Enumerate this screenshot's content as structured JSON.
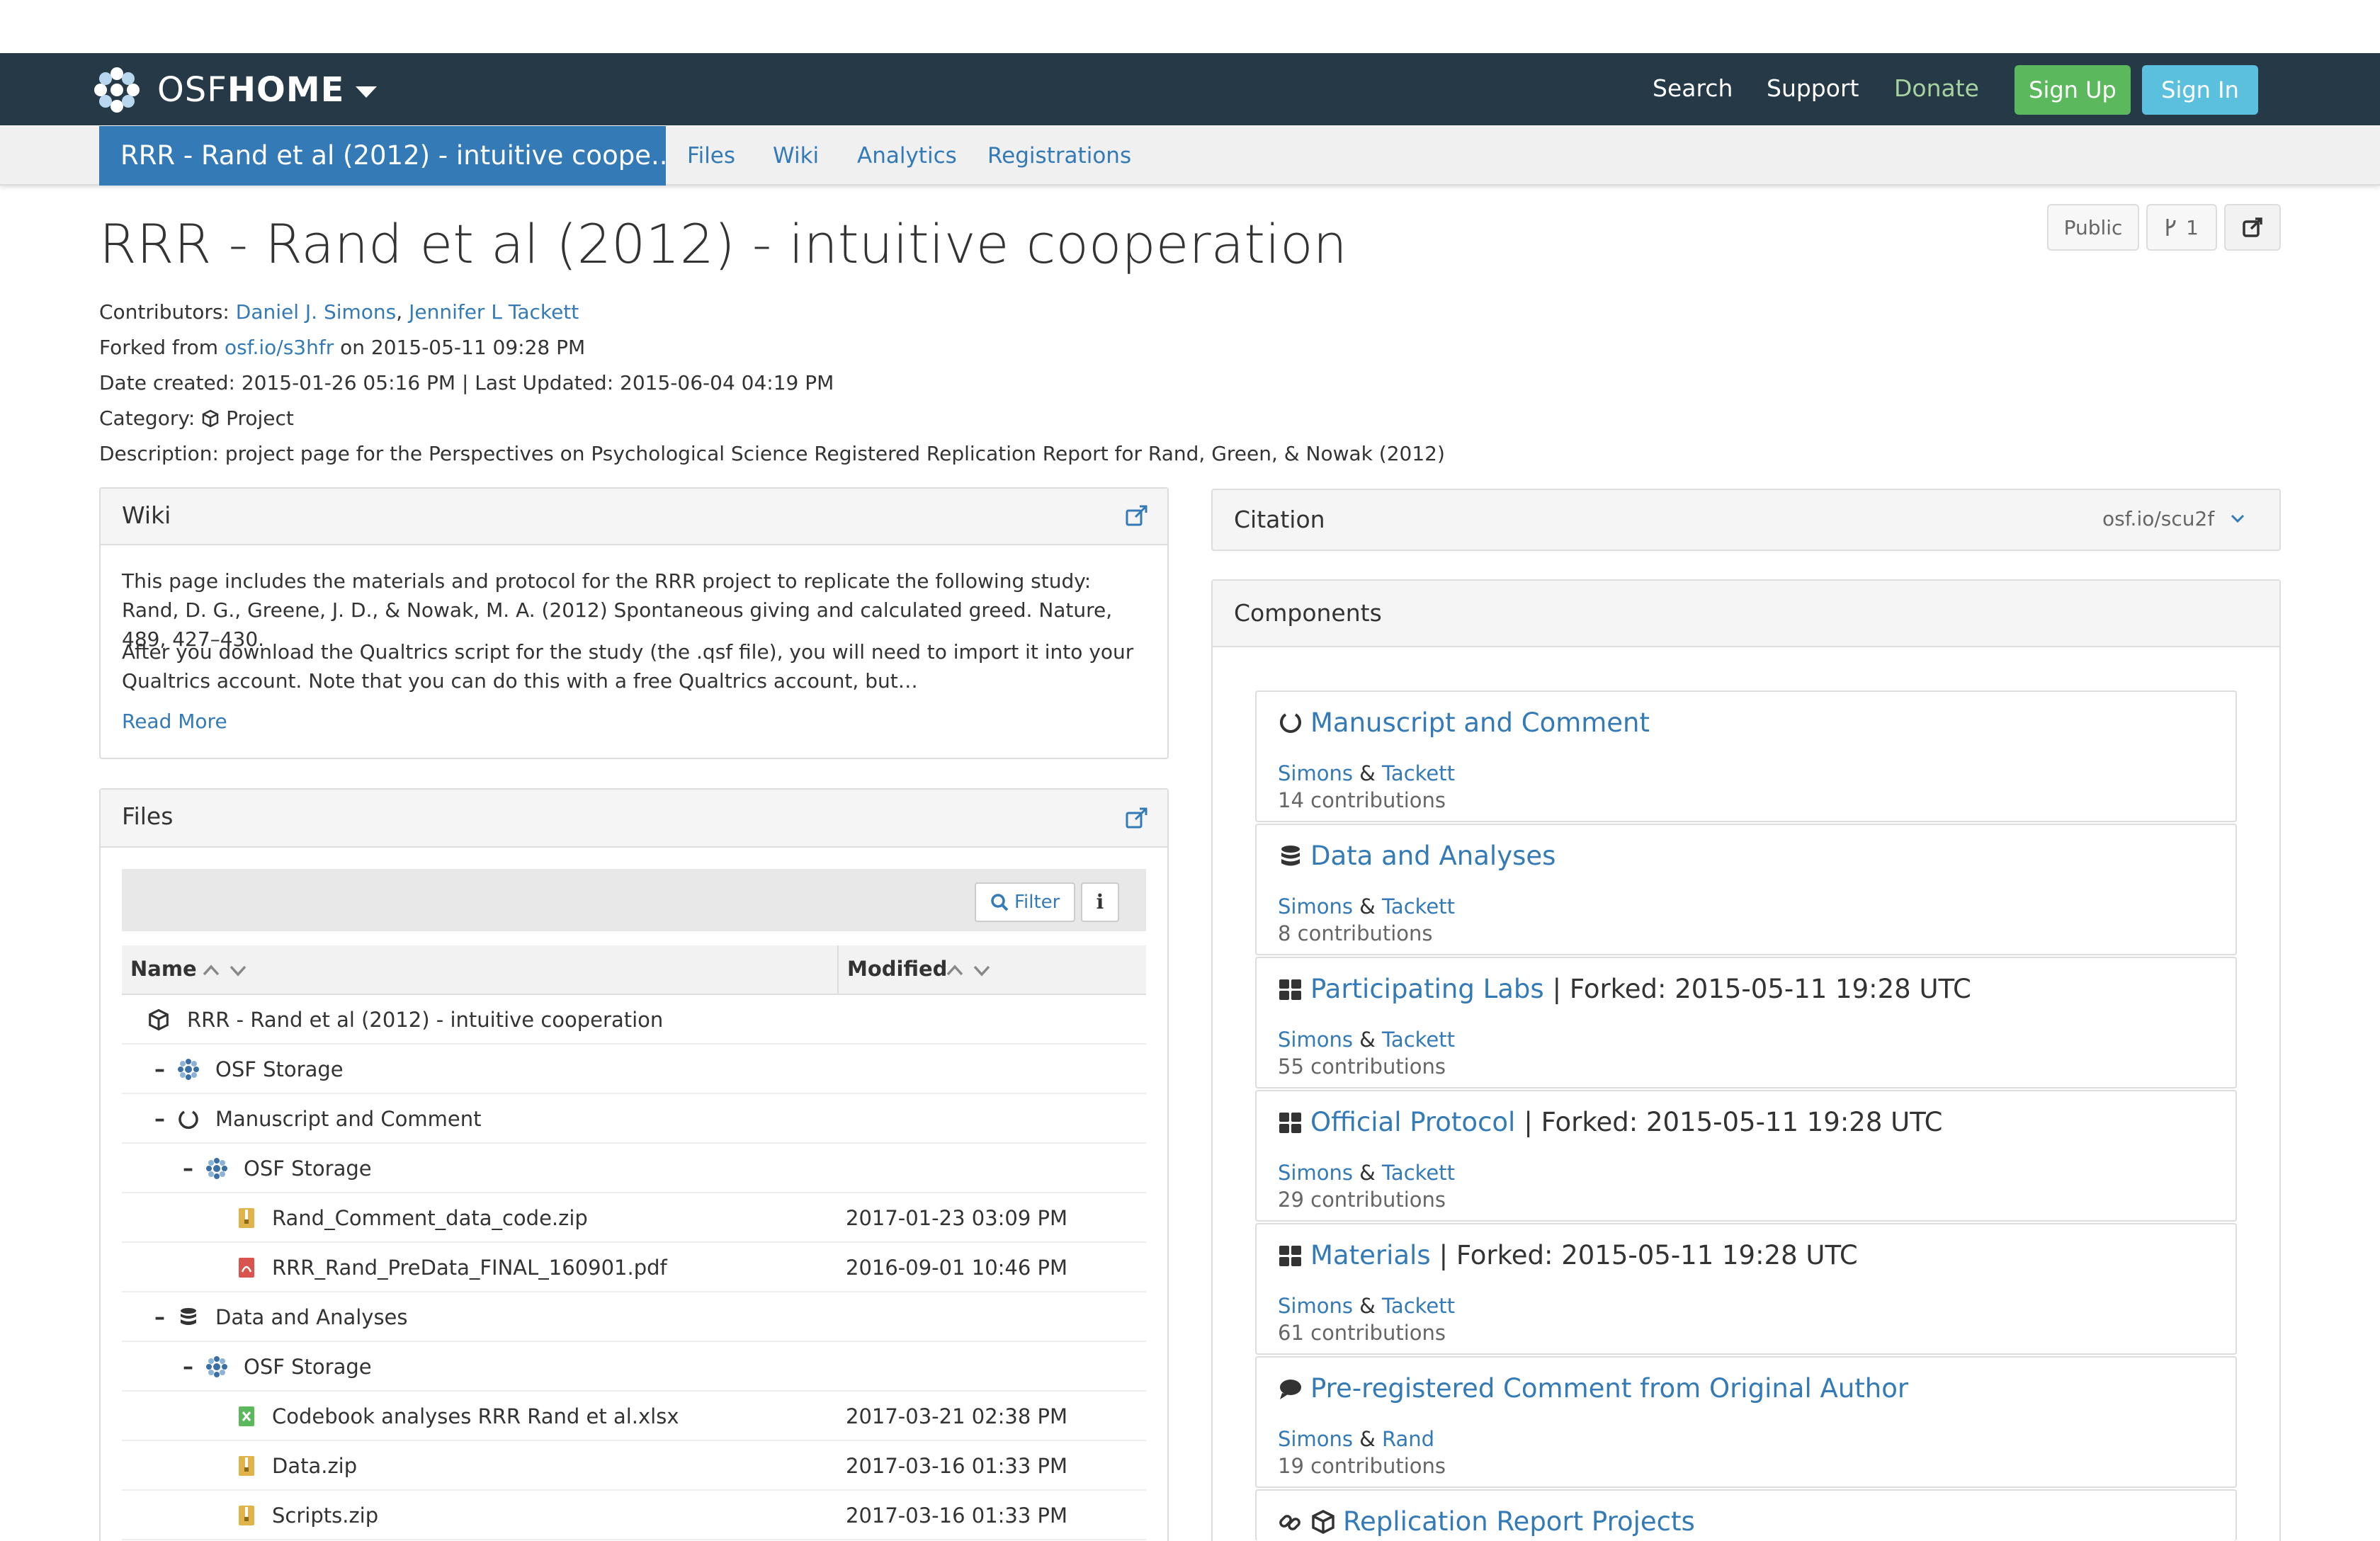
{
  "navbar": {
    "brand_prefix": "OSF",
    "brand_suffix": "HOME",
    "links": {
      "search": "Search",
      "support": "Support",
      "donate": "Donate"
    },
    "sign_up": "Sign Up",
    "sign_in": "Sign In",
    "colors": {
      "bar": "#263947",
      "donate": "#a7d3a0",
      "sign_up": "#5cb85c",
      "sign_in": "#5bc0de"
    }
  },
  "subnav": {
    "project_short": "RRR - Rand et al (2012) - intuitive coope...",
    "tabs": {
      "files": "Files",
      "wiki": "Wiki",
      "analytics": "Analytics",
      "registrations": "Registrations"
    }
  },
  "header": {
    "title": "RRR - Rand et al (2012) - intuitive cooperation",
    "public_label": "Public",
    "fork_count": "1",
    "contributors_label": "Contributors:",
    "contributors": [
      "Daniel J. Simons",
      "Jennifer L Tackett"
    ],
    "forked_label": "Forked from",
    "forked_link": "osf.io/s3hfr",
    "forked_date": "on 2015-05-11 09:28 PM",
    "dates": "Date created: 2015-01-26 05:16 PM | Last Updated: 2015-06-04 04:19 PM",
    "category_label": "Category:",
    "category": "Project",
    "description": "Description: project page for the Perspectives on Psychological Science Registered Replication Report for Rand, Green, & Nowak (2012)"
  },
  "wiki": {
    "title": "Wiki",
    "para1": "This page includes the materials and protocol for the RRR project to replicate the following study: Rand, D. G., Greene, J. D., & Nowak, M. A. (2012) Spontaneous giving and calculated greed. Nature, 489, 427–430.",
    "para2": "After you download the Qualtrics script for the study (the .qsf file), you will need to import it into your Qualtrics account. Note that you can do this with a free Qualtrics account, but…",
    "read_more": "Read More"
  },
  "files": {
    "title": "Files",
    "filter_label": "Filter",
    "col_name": "Name",
    "col_modified": "Modified",
    "rows": [
      {
        "name": "RRR - Rand et al (2012) - intuitive cooperation",
        "modified": ""
      },
      {
        "name": "OSF Storage",
        "modified": ""
      },
      {
        "name": "Manuscript and Comment",
        "modified": ""
      },
      {
        "name": "OSF Storage",
        "modified": ""
      },
      {
        "name": "Rand_Comment_data_code.zip",
        "modified": "2017-01-23 03:09 PM"
      },
      {
        "name": "RRR_Rand_PreData_FINAL_160901.pdf",
        "modified": "2016-09-01 10:46 PM"
      },
      {
        "name": "Data and Analyses",
        "modified": ""
      },
      {
        "name": "OSF Storage",
        "modified": ""
      },
      {
        "name": "Codebook analyses RRR Rand et al.xlsx",
        "modified": "2017-03-21 02:38 PM"
      },
      {
        "name": "Data.zip",
        "modified": "2017-03-16 01:33 PM"
      },
      {
        "name": "Scripts.zip",
        "modified": "2017-03-16 01:33 PM"
      }
    ]
  },
  "citation": {
    "title": "Citation",
    "link": "osf.io/scu2f"
  },
  "components": {
    "title": "Components",
    "items": [
      {
        "icon": "circle-notch-icon",
        "title": "Manuscript and Comment",
        "forked": "",
        "author1": "Simons",
        "amp": "&",
        "author2": "Tackett",
        "contributions": "14 contributions"
      },
      {
        "icon": "database-icon",
        "title": "Data and Analyses",
        "forked": "",
        "author1": "Simons",
        "amp": "&",
        "author2": "Tackett",
        "contributions": "8 contributions"
      },
      {
        "icon": "grid-icon",
        "title": "Participating Labs",
        "forked": "| Forked: 2015-05-11 19:28 UTC",
        "author1": "Simons",
        "amp": "&",
        "author2": "Tackett",
        "contributions": "55 contributions"
      },
      {
        "icon": "grid-icon",
        "title": "Official Protocol",
        "forked": "| Forked: 2015-05-11 19:28 UTC",
        "author1": "Simons",
        "amp": "&",
        "author2": "Tackett",
        "contributions": "29 contributions"
      },
      {
        "icon": "grid-icon",
        "title": "Materials",
        "forked": "| Forked: 2015-05-11 19:28 UTC",
        "author1": "Simons",
        "amp": "&",
        "author2": "Tackett",
        "contributions": "61 contributions"
      },
      {
        "icon": "comment-icon",
        "title": "Pre-registered Comment from Original Author",
        "forked": "",
        "author1": "Simons",
        "amp": "&",
        "author2": "Rand",
        "contributions": "19 contributions"
      },
      {
        "icon": "link-cube-icon",
        "title": "Replication Report Projects",
        "forked": "",
        "author1": "",
        "amp": "",
        "author2": "",
        "contributions": ""
      }
    ]
  }
}
